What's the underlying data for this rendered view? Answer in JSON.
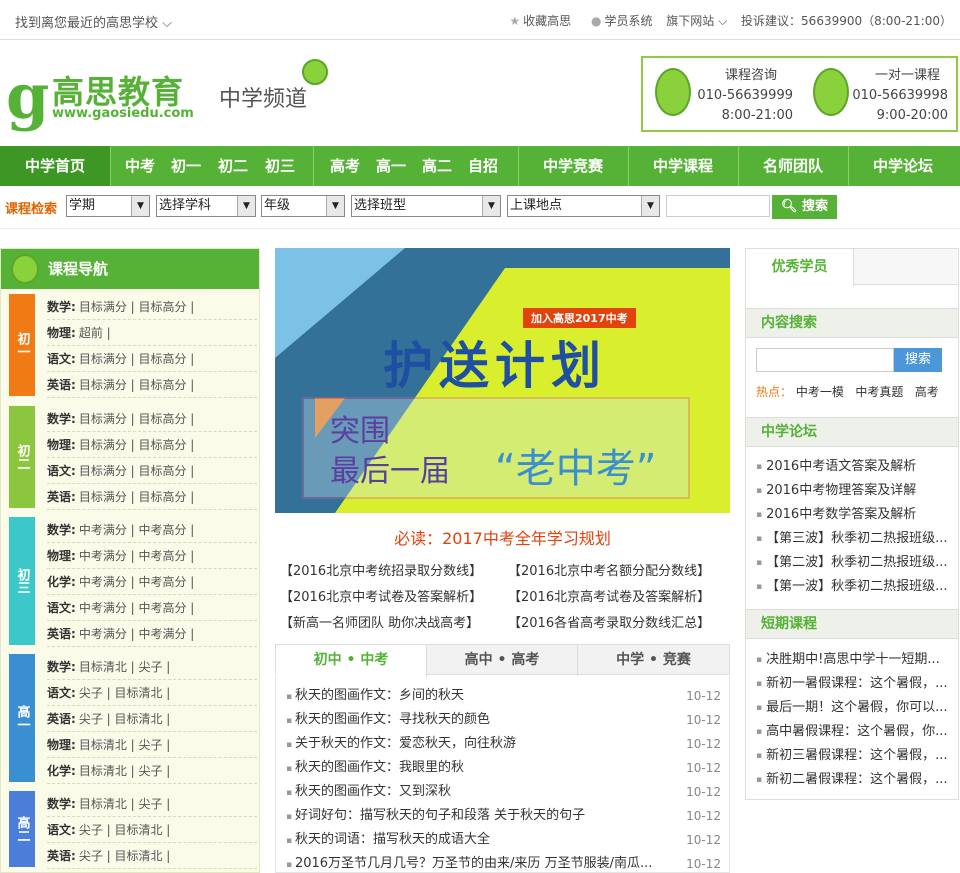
{
  "topbar": {
    "left": "找到离您最近的高思学校 ⌵",
    "favorite": "收藏高思",
    "student": "学员系统",
    "sites": "旗下网站 ⌵",
    "complaint": "投诉建议：56639900（8:00-21:00）"
  },
  "header": {
    "logo_text": "高思教育",
    "logo_url": "www.gaosiedu.com",
    "channel": "中学频道",
    "contact1": {
      "title": "课程咨询",
      "phone": "010-56639999",
      "hours": "8:00-21:00"
    },
    "contact2": {
      "title": "一对一课程",
      "phone": "010-56639998",
      "hours": "9:00-20:00"
    }
  },
  "nav": [
    "中学首页",
    "中考",
    "初一",
    "初二",
    "初三",
    "高考",
    "高一",
    "高二",
    "自招",
    "中学竞赛",
    "中学课程",
    "名师团队",
    "中学论坛"
  ],
  "search": {
    "label": "课程检索",
    "selects": [
      "学期",
      "选择学科",
      "年级",
      "选择班型",
      "上课地点"
    ],
    "button": "搜索"
  },
  "left": {
    "title": "课程导航",
    "groups": [
      {
        "tag": "初一",
        "color": "#f07a14",
        "rows": [
          [
            "数学:",
            "目标满分 | 目标高分 |"
          ],
          [
            "物理:",
            "超前 |"
          ],
          [
            "语文:",
            "目标满分 | 目标高分 |"
          ],
          [
            "英语:",
            "目标满分 | 目标高分 |"
          ]
        ]
      },
      {
        "tag": "初二",
        "color": "#8cc63f",
        "rows": [
          [
            "数学:",
            "目标满分 | 目标高分 |"
          ],
          [
            "物理:",
            "目标满分 | 目标高分 |"
          ],
          [
            "语文:",
            "目标满分 | 目标高分 |"
          ],
          [
            "英语:",
            "目标满分 | 目标高分 |"
          ]
        ]
      },
      {
        "tag": "初三",
        "color": "#3cc8c8",
        "rows": [
          [
            "数学:",
            "中考满分 | 中考高分 |"
          ],
          [
            "物理:",
            "中考满分 | 中考高分 |"
          ],
          [
            "化学:",
            "中考满分 | 中考高分 |"
          ],
          [
            "语文:",
            "中考满分 | 中考高分 |"
          ],
          [
            "英语:",
            "中考满分 | 中考满分 |"
          ]
        ]
      },
      {
        "tag": "高一",
        "color": "#3a8fd0",
        "rows": [
          [
            "数学:",
            "目标清北 | 尖子 |"
          ],
          [
            "语文:",
            "尖子 | 目标清北 |"
          ],
          [
            "英语:",
            "尖子 | 目标清北 |"
          ],
          [
            "物理:",
            "目标清北 | 尖子 |"
          ],
          [
            "化学:",
            "目标清北 | 尖子 |"
          ]
        ]
      },
      {
        "tag": "高二",
        "color": "#4a7ed8",
        "rows": [
          [
            "数学:",
            "目标清北 | 尖子 |"
          ],
          [
            "语文:",
            "尖子 | 目标清北 |"
          ],
          [
            "英语:",
            "尖子 | 目标清北 |"
          ]
        ]
      }
    ]
  },
  "banner": {
    "tag": "加入高思2017中考",
    "main": "护送计划",
    "line1": "突围",
    "line2": "最后一届",
    "quote": "“老中考”"
  },
  "mid": {
    "title": "必读：2017中考全年学习规划",
    "links": [
      "【2016北京中考统招录取分数线】",
      "【2016北京中考名额分配分数线】",
      "【2016北京中考试卷及答案解析】",
      "【2016北京高考试卷及答案解析】",
      "【新高一名师团队 助你决战高考】",
      "【2016各省高考录取分数线汇总】"
    ]
  },
  "tabs": [
    "初中 • 中考",
    "高中 • 高考",
    "中学 • 竞赛"
  ],
  "news": [
    {
      "t": "秋天的图画作文：乡间的秋天",
      "d": "10-12"
    },
    {
      "t": "秋天的图画作文：寻找秋天的颜色",
      "d": "10-12"
    },
    {
      "t": "关于秋天的作文：爱恋秋天，向往秋游",
      "d": "10-12"
    },
    {
      "t": "秋天的图画作文：我眼里的秋",
      "d": "10-12"
    },
    {
      "t": "秋天的图画作文：又到深秋",
      "d": "10-12"
    },
    {
      "t": "好词好句：描写秋天的句子和段落 关于秋天的句子",
      "d": "10-12"
    },
    {
      "t": "秋天的词语：描写秋天的成语大全",
      "d": "10-12"
    },
    {
      "t": "2016万圣节几月几号？万圣节的由来/来历 万圣节服装/南瓜...",
      "d": "10-12"
    }
  ],
  "right": {
    "tab": "优秀学员",
    "search_title": "内容搜索",
    "search_btn": "搜索",
    "hot_label": "热点：",
    "hot": [
      "中考一模",
      "中考真题",
      "高考"
    ],
    "forum_title": "中学论坛",
    "forum": [
      "2016中考语文答案及解析",
      "2016中考物理答案及详解",
      "2016中考数学答案及解析",
      "【第三波】秋季初二热报班级...",
      "【第二波】秋季初二热报班级...",
      "【第一波】秋季初二热报班级..."
    ],
    "short_title": "短期课程",
    "short": [
      "决胜期中!高思中学十一短期...",
      "新初一暑假课程：这个暑假，...",
      "最后一期！这个暑假，你可以...",
      "高中暑假课程：这个暑假，你...",
      "新初三暑假课程：这个暑假，...",
      "新初二暑假课程：这个暑假，..."
    ]
  },
  "colors": {
    "brand": "#56b236",
    "accent": "#e2420c"
  }
}
